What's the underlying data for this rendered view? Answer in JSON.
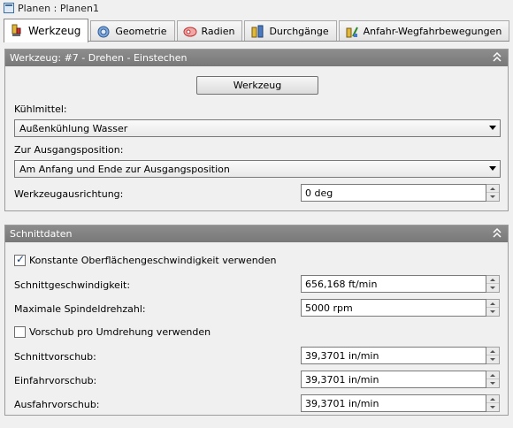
{
  "window": {
    "title": "Planen : Planen1",
    "icon": "window-icon"
  },
  "tabs": [
    {
      "label": "Werkzeug",
      "icon": "tool-icon",
      "active": true
    },
    {
      "label": "Geometrie",
      "icon": "geometry-icon",
      "active": false
    },
    {
      "label": "Radien",
      "icon": "radii-icon",
      "active": false
    },
    {
      "label": "Durchgänge",
      "icon": "passes-icon",
      "active": false
    },
    {
      "label": "Anfahr-Wegfahrbewegungen",
      "icon": "approach-icon",
      "active": false
    }
  ],
  "werkzeug_panel": {
    "title": "Werkzeug: #7 - Drehen - Einstechen",
    "tool_button": "Werkzeug",
    "coolant_label": "Kühlmittel:",
    "coolant_value": "Außenkühlung Wasser",
    "home_label": "Zur Ausgangsposition:",
    "home_value": "Am Anfang und Ende zur Ausgangsposition",
    "orientation_label": "Werkzeugausrichtung:",
    "orientation_value": "0 deg"
  },
  "schnittdaten_panel": {
    "title": "Schnittdaten",
    "css_label": "Konstante Oberflächengeschwindigkeit verwenden",
    "css_checked": true,
    "cut_speed_label": "Schnittgeschwindigkeit:",
    "cut_speed_value": "656,168 ft/min",
    "max_spindle_label": "Maximale Spindeldrehzahl:",
    "max_spindle_value": "5000 rpm",
    "feed_per_rev_label": "Vorschub pro Umdrehung verwenden",
    "feed_per_rev_checked": false,
    "cut_feed_label": "Schnittvorschub:",
    "cut_feed_value": "39,3701 in/min",
    "lead_in_label": "Einfahrvorschub:",
    "lead_in_value": "39,3701 in/min",
    "lead_out_label": "Ausfahrvorschub:",
    "lead_out_value": "39,3701 in/min"
  },
  "colors": {
    "panel_header": "#808080",
    "accent": "#1f3f73"
  }
}
